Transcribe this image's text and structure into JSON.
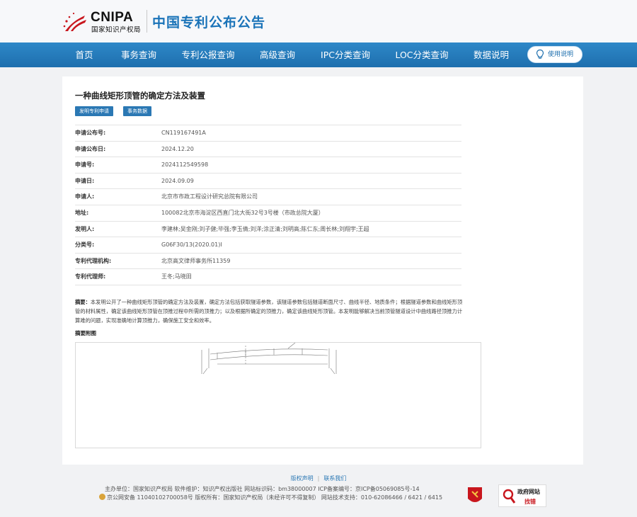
{
  "header": {
    "logo_text": "CNIPA",
    "logo_subtitle": "国家知识产权局",
    "site_title": "中国专利公布公告"
  },
  "nav": {
    "items": [
      "首页",
      "事务查询",
      "专利公报查询",
      "高级查询",
      "IPC分类查询",
      "LOC分类查询",
      "数据说明"
    ],
    "help_label": "使用说明"
  },
  "patent": {
    "title": "一种曲线矩形顶管的确定方法及装置",
    "buttons": [
      "发明专利申请",
      "事务数据"
    ],
    "fields": [
      {
        "label": "申请公布号:",
        "value": "CN119167491A"
      },
      {
        "label": "申请公布日:",
        "value": "2024.12.20"
      },
      {
        "label": "申请号:",
        "value": "2024112549598"
      },
      {
        "label": "申请日:",
        "value": "2024.09.09"
      },
      {
        "label": "申请人:",
        "value": "北京市市政工程设计研究总院有限公司"
      },
      {
        "label": "地址:",
        "value": "100082北京市海淀区西直门北大街32号3号楼（市政总院大厦）"
      },
      {
        "label": "发明人:",
        "value": "李建林;吴金刚;刘子健;毕强;李玉倩;刘洋;涂正清;刘明高;陈仁东;周长林;刘翔宇;王超"
      },
      {
        "label": "分类号:",
        "value": "G06F30/13(2020.01)I"
      },
      {
        "label": "专利代理机构:",
        "value": "北京高文律师事务所11359"
      },
      {
        "label": "专利代理师:",
        "value": "王冬;马晓田"
      }
    ],
    "abstract_label": "摘要：",
    "abstract_text": "本发明公开了一种曲线矩形顶管的确定方法及装置，确定方法包括获取隧道参数，该隧道参数包括隧道断面尺寸、曲线半径、地质条件；根据隧道参数和曲线矩形顶管的材料属性，确定该曲线矩形顶管在顶推过程中所需的顶推力；以及根据所确定的顶推力，确定该曲线矩形顶管。本发明能够解决当前顶管隧道设计中曲线路径顶推力计算难的问题，实现准确地计算顶推力，确保施工安全和效率。",
    "figure_label": "摘要附图"
  },
  "footer": {
    "links": [
      "版权声明",
      "联系我们"
    ],
    "line1": "主办单位：国家知识产权局   软件维护：知识产权出版社   网站标识码：bm38000007   ICP备案编号：京ICP备05069085号-14",
    "police": "京公网安备 11040102700058号",
    "line2_rest": "版权所有：国家知识产权局（未经许可不得复制）   网站技术支持：010-62086466 / 6421 / 6415",
    "gov_badge_title": "政府网站",
    "gov_badge_sub": "找错"
  }
}
